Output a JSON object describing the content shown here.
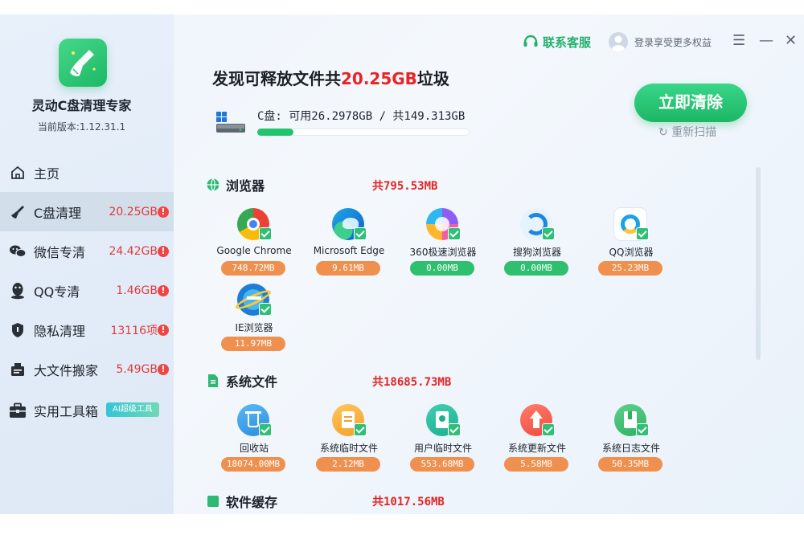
{
  "app": {
    "title": "灵动C盘清理专家",
    "version": "当前版本:1.12.31.1"
  },
  "sidebar": {
    "items": [
      {
        "label": "主页",
        "size": "",
        "alert": ""
      },
      {
        "label": "C盘清理",
        "size": "20.25GB",
        "alert": "!"
      },
      {
        "label": "微信专清",
        "size": "24.42GB",
        "alert": "!"
      },
      {
        "label": "QQ专清",
        "size": "1.46GB",
        "alert": "!"
      },
      {
        "label": "隐私清理",
        "size": "13116项",
        "alert": "!"
      },
      {
        "label": "大文件搬家",
        "size": "5.49GB",
        "alert": "!"
      },
      {
        "label": "实用工具箱",
        "size": "",
        "alert": "",
        "badge": "AI超级工具"
      }
    ]
  },
  "header": {
    "service_label": "联系客服",
    "login_label": "登录享受更多权益",
    "menu_glyph": "☰",
    "min_glyph": "—",
    "close_glyph": "✕"
  },
  "main": {
    "headline_prefix": "发现可释放文件共",
    "headline_amount": "20.25GB",
    "headline_suffix": "垃圾",
    "drive_text": "C盘: 可用26.2978GB / 共149.313GB",
    "drive_used_fraction": 0.17,
    "clean_button": "立即清除",
    "rescan_label": "重新扫描"
  },
  "sections": [
    {
      "title": "浏览器",
      "total": "共795.53MB",
      "items": [
        {
          "name": "Google Chrome",
          "size": "748.72MB",
          "status": "orange",
          "icon": "chrome-icon"
        },
        {
          "name": "Microsoft Edge",
          "size": "9.61MB",
          "status": "orange",
          "icon": "edge-icon"
        },
        {
          "name": "360极速浏览器",
          "size": "0.00MB",
          "status": "green",
          "icon": "360-browser-icon"
        },
        {
          "name": "搜狗浏览器",
          "size": "0.00MB",
          "status": "green",
          "icon": "sogou-browser-icon"
        },
        {
          "name": "QQ浏览器",
          "size": "25.23MB",
          "status": "orange",
          "icon": "qq-browser-icon"
        },
        {
          "name": "IE浏览器",
          "size": "11.97MB",
          "status": "orange",
          "icon": "ie-icon"
        }
      ]
    },
    {
      "title": "系统文件",
      "total": "共18685.73MB",
      "items": [
        {
          "name": "回收站",
          "size": "18074.00MB",
          "status": "orange",
          "icon": "recycle-bin-icon"
        },
        {
          "name": "系统临时文件",
          "size": "2.12MB",
          "status": "orange",
          "icon": "system-temp-icon"
        },
        {
          "name": "用户临时文件",
          "size": "553.68MB",
          "status": "orange",
          "icon": "user-temp-icon"
        },
        {
          "name": "系统更新文件",
          "size": "5.58MB",
          "status": "orange",
          "icon": "system-update-icon"
        },
        {
          "name": "系统日志文件",
          "size": "50.35MB",
          "status": "orange",
          "icon": "system-log-icon"
        }
      ]
    },
    {
      "title": "软件缓存",
      "total": "共1017.56MB"
    }
  ]
}
